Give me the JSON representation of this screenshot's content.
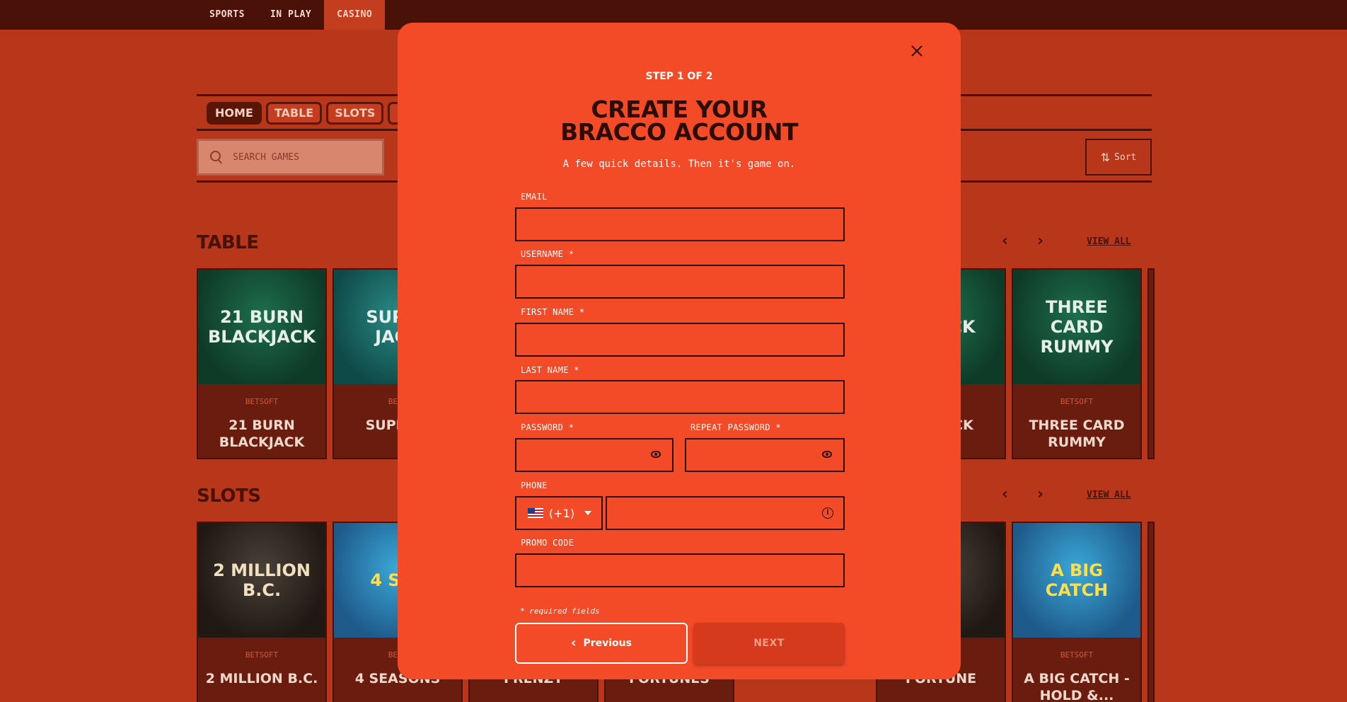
{
  "topnav": {
    "items": [
      "SPORTS",
      "IN PLAY",
      "CASINO"
    ],
    "active": "CASINO"
  },
  "categories": [
    "HOME",
    "TABLE",
    "SLOTS"
  ],
  "search": {
    "placeholder": "SEARCH GAMES"
  },
  "sort": {
    "label": "Sort"
  },
  "sections": {
    "table": {
      "title": "TABLE",
      "view_all": "VIEW ALL",
      "games": [
        {
          "art": "21 BURN BLACKJACK",
          "provider": "BETSOFT",
          "name": "21 BURN BLACKJACK"
        },
        {
          "art": "SUPRE JACK",
          "provider": "BETS",
          "name": "SUPR 77"
        },
        {
          "art": "ECK CK",
          "provider": "",
          "name": "ECK ACK"
        },
        {
          "art": "THREE CARD RUMMY",
          "provider": "BETSOFT",
          "name": "THREE CARD RUMMY"
        }
      ]
    },
    "slots": {
      "title": "SLOTS",
      "view_all": "VIEW ALL",
      "games": [
        {
          "art": "2 MILLION B.C.",
          "provider": "BETSOFT",
          "name": "2 MILLION B.C."
        },
        {
          "art": "4 SEA",
          "provider": "BETS",
          "name": "4 SEASONS"
        },
        {
          "art": "",
          "provider": "",
          "name": "FRENZY"
        },
        {
          "art": "",
          "provider": "",
          "name": "FORTUNES"
        },
        {
          "art": "",
          "provider": "",
          "name": ""
        },
        {
          "art": "",
          "provider": "",
          "name": "FORTUNE"
        },
        {
          "art": "A BIG CATCH",
          "provider": "BETSOFT",
          "name": "A BIG CATCH - HOLD &..."
        }
      ]
    }
  },
  "modal": {
    "step": "STEP 1 OF 2",
    "title_line1": "CREATE YOUR",
    "title_line2": "BRACCO ACCOUNT",
    "subtitle": "A few quick details. Then it's game on.",
    "fields": {
      "email": {
        "label": "EMAIL",
        "value": ""
      },
      "username": {
        "label": "USERNAME *",
        "value": ""
      },
      "first_name": {
        "label": "FIRST NAME *",
        "value": ""
      },
      "last_name": {
        "label": "LAST NAME *",
        "value": ""
      },
      "password": {
        "label": "PASSWORD *",
        "value": ""
      },
      "repeat_password": {
        "label": "REPEAT PASSWORD *",
        "value": ""
      },
      "phone": {
        "label": "PHONE",
        "country_code": "(+1)",
        "value": ""
      },
      "promo_code": {
        "label": "PROMO CODE",
        "value": ""
      }
    },
    "required_note": "* required fields",
    "previous_label": "Previous",
    "next_label": "NEXT"
  },
  "colors": {
    "page_bg": "#b8371a",
    "nav_bg": "#4a1108",
    "modal_bg": "#f34a27",
    "dark_text": "#2b0d06"
  }
}
